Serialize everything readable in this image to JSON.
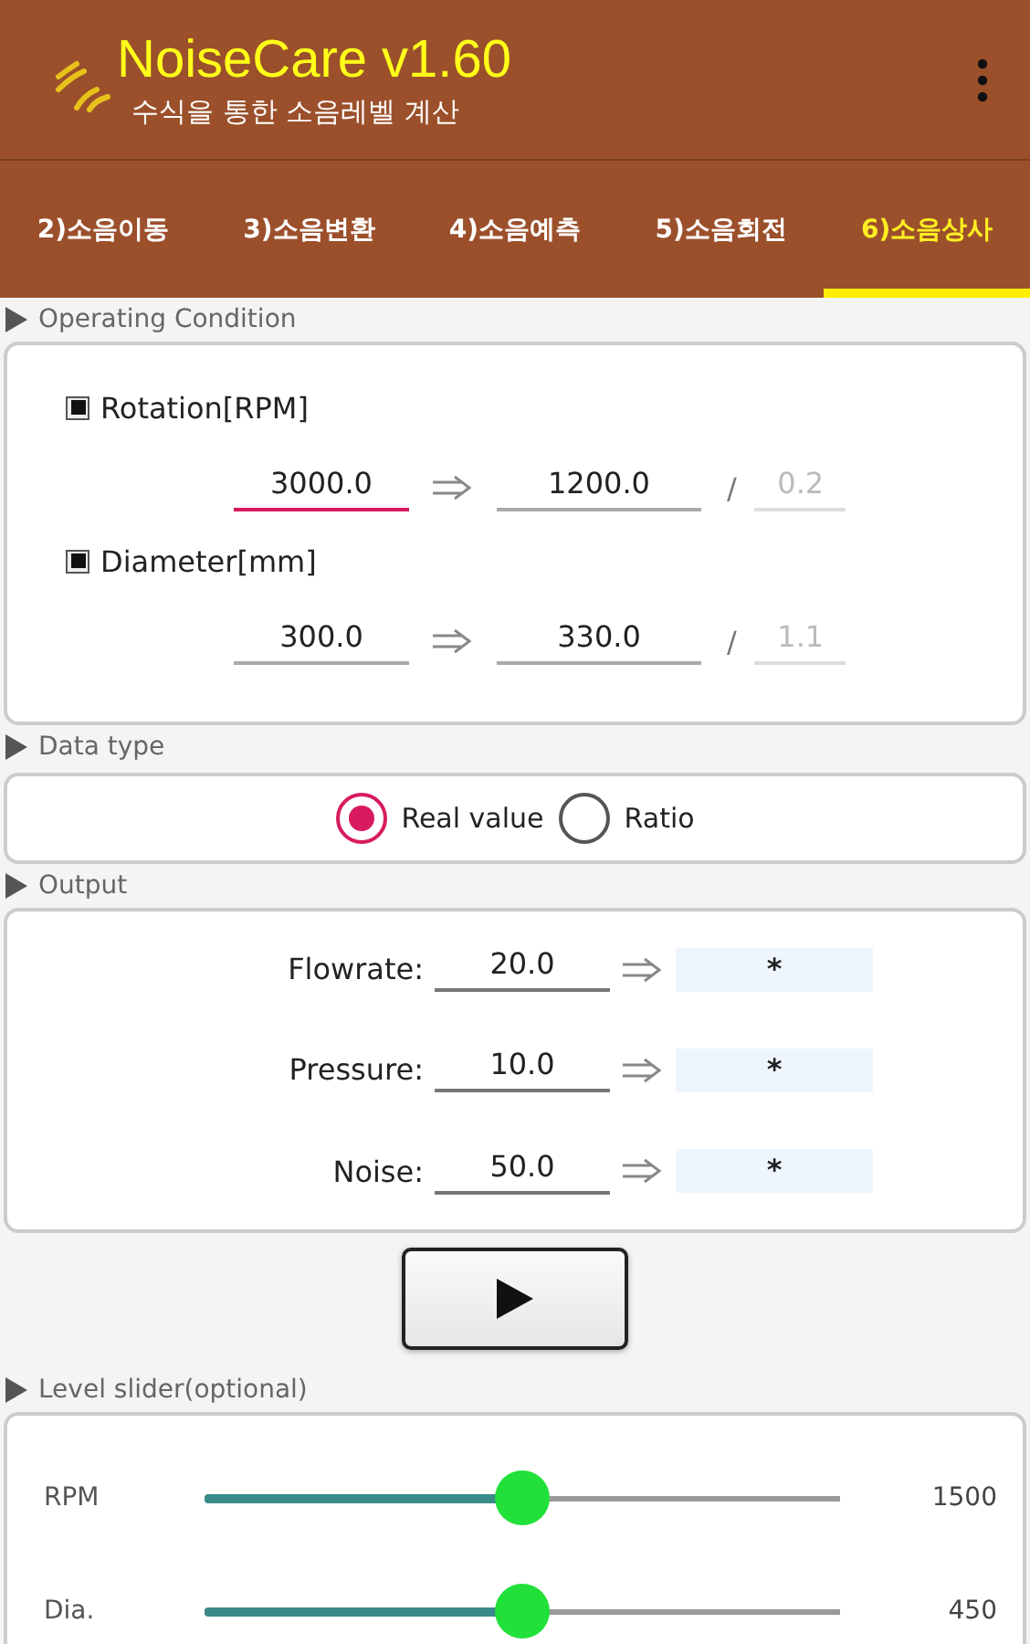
{
  "app_bar": {
    "title": "NoiseCare v1.60",
    "subtitle": "수식을 통한 소음레벨 계산"
  },
  "tabs": [
    {
      "label": "2)소음이동",
      "selected": false
    },
    {
      "label": "3)소음변환",
      "selected": false
    },
    {
      "label": "4)소음예측",
      "selected": false
    },
    {
      "label": "5)소음회전",
      "selected": false
    },
    {
      "label": "6)소음상사",
      "selected": true
    }
  ],
  "operating_condition": {
    "heading": "Operating Condition",
    "rows": [
      {
        "label": "Rotation[RPM]",
        "from": {
          "value": "3000.0",
          "focused": true
        },
        "to": "1200.0",
        "separator": "/",
        "ratio": "0.2"
      },
      {
        "label": "Diameter[mm]",
        "from": {
          "value": "300.0",
          "focused": false
        },
        "to": "330.0",
        "separator": "/",
        "ratio": "1.1"
      }
    ]
  },
  "data_type": {
    "heading": "Data type",
    "options": [
      {
        "label": "Real value",
        "selected": true
      },
      {
        "label": "Ratio",
        "selected": false
      }
    ]
  },
  "output": {
    "heading": "Output",
    "rows": [
      {
        "label": "Flowrate:",
        "value": "20.0",
        "result": "*"
      },
      {
        "label": "Pressure:",
        "value": "10.0",
        "result": "*"
      },
      {
        "label": "Noise:",
        "value": "50.0",
        "result": "*"
      }
    ]
  },
  "level_slider": {
    "heading": "Level slider(optional)",
    "sliders": [
      {
        "label": "RPM",
        "level": 0.5,
        "reading": "1500"
      },
      {
        "label": "Dia.",
        "level": 0.5,
        "reading": "450"
      }
    ]
  }
}
